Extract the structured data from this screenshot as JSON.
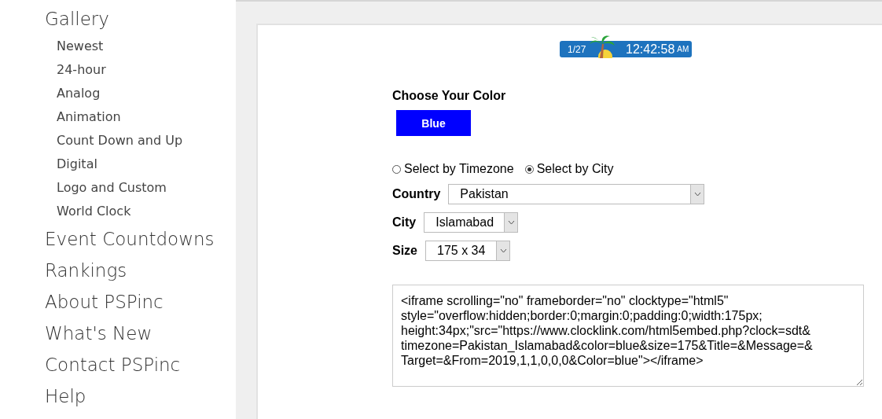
{
  "sidebar": {
    "items": [
      {
        "label": "Gallery",
        "children": [
          {
            "label": "Newest"
          },
          {
            "label": "24-hour"
          },
          {
            "label": "Analog"
          },
          {
            "label": "Animation"
          },
          {
            "label": "Count Down and Up"
          },
          {
            "label": "Digital"
          },
          {
            "label": "Logo and Custom"
          },
          {
            "label": "World Clock"
          }
        ]
      },
      {
        "label": "Event Countdowns"
      },
      {
        "label": "Rankings"
      },
      {
        "label": "About PSPinc"
      },
      {
        "label": "What's New"
      },
      {
        "label": "Contact PSPinc"
      },
      {
        "label": "Help"
      }
    ]
  },
  "clock": {
    "date": "1/27",
    "time": "12:42:58",
    "ampm": "AM"
  },
  "color_section": {
    "heading": "Choose Your Color",
    "button": "Blue",
    "color": "#0000ff"
  },
  "select_mode": [
    {
      "label": "Select by Timezone",
      "selected": false
    },
    {
      "label": "Select by City",
      "selected": true
    }
  ],
  "fields": [
    {
      "label": "Country",
      "value": "Pakistan",
      "kind": "wide"
    },
    {
      "label": "City",
      "value": "Islamabad",
      "kind": "narrow"
    },
    {
      "label": "Size",
      "value": "175 x 34",
      "kind": "narrow"
    }
  ],
  "embed_code": "<iframe scrolling=\"no\" frameborder=\"no\" clocktype=\"html5\"\nstyle=\"overflow:hidden;border:0;margin:0;padding:0;width:175px;\nheight:34px;\"src=\"https://www.clocklink.com/html5embed.php?clock=sdt&\ntimezone=Pakistan_Islamabad&color=blue&size=175&Title=&Message=&\nTarget=&From=2019,1,1,0,0,0&Color=blue\"></iframe>"
}
